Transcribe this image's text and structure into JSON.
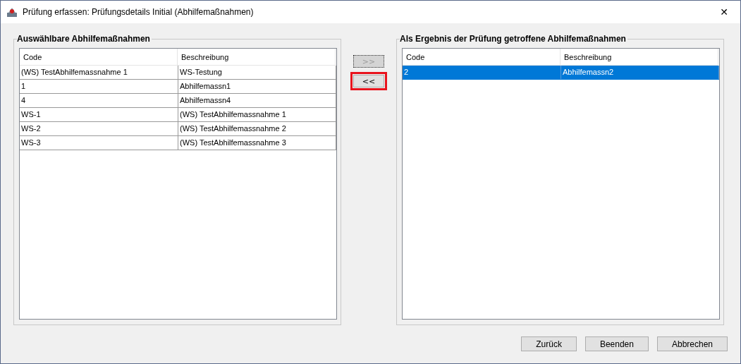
{
  "window": {
    "title": "Prüfung erfassen: Prüfungsdetails Initial (Abhilfemaßnahmen)",
    "close": "✕"
  },
  "available": {
    "title": "Auswählbare Abhilfemaßnahmen",
    "columns": [
      "Code",
      "Beschreibung"
    ],
    "rows": [
      {
        "cells": [
          "(WS) TestAbhilfemassnahme 1",
          "WS-Testung"
        ],
        "selected": false
      },
      {
        "cells": [
          "1",
          "Abhilfemassn1"
        ],
        "selected": false
      },
      {
        "cells": [
          "4",
          "Abhilfemassn4"
        ],
        "selected": false
      },
      {
        "cells": [
          "WS-1",
          "(WS) TestAbhilfemassnahme 1"
        ],
        "selected": false
      },
      {
        "cells": [
          "WS-2",
          "(WS) TestAbhilfemassnahme 2"
        ],
        "selected": false
      },
      {
        "cells": [
          "WS-3",
          "(WS) TestAbhilfemassnahme 3"
        ],
        "selected": false
      }
    ]
  },
  "transfer_buttons": [
    {
      "label": ">>",
      "disabled": true,
      "highlighted": false
    },
    {
      "label": "<<",
      "disabled": false,
      "highlighted": true
    }
  ],
  "taken": {
    "title": "Als Ergebnis der Prüfung getroffene Abhilfemaßnahmen",
    "columns": [
      "Code",
      "Beschreibung"
    ],
    "rows": [
      {
        "cells": [
          "2",
          "Abhilfemassn2"
        ],
        "selected": true
      }
    ]
  },
  "buttons": [
    "Zurück",
    "Beenden",
    "Abbrechen"
  ]
}
